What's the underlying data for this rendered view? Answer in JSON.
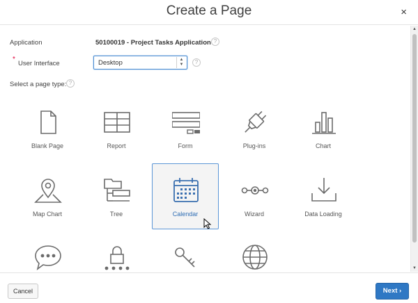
{
  "dialog": {
    "title": "Create a Page",
    "close_icon": "×"
  },
  "form": {
    "application_label": "Application",
    "application_value": "50100019 - Project Tasks Application",
    "ui_label": "User Interface",
    "ui_required_marker": "*",
    "ui_value": "Desktop",
    "page_type_label": "Select a page type:",
    "help_glyph": "?"
  },
  "page_types": [
    {
      "label": "Blank Page",
      "icon": "blank-page-icon"
    },
    {
      "label": "Report",
      "icon": "report-icon"
    },
    {
      "label": "Form",
      "icon": "form-icon"
    },
    {
      "label": "Plug-ins",
      "icon": "plug-icon"
    },
    {
      "label": "Chart",
      "icon": "chart-icon"
    },
    {
      "label": "Map Chart",
      "icon": "map-pin-icon"
    },
    {
      "label": "Tree",
      "icon": "tree-icon"
    },
    {
      "label": "Calendar",
      "icon": "calendar-icon",
      "selected": true
    },
    {
      "label": "Wizard",
      "icon": "wizard-icon"
    },
    {
      "label": "Data Loading",
      "icon": "data-loading-icon"
    },
    {
      "label": "",
      "icon": "chat-bubble-icon"
    },
    {
      "label": "",
      "icon": "lock-icon"
    },
    {
      "label": "",
      "icon": "key-icon"
    },
    {
      "label": "",
      "icon": "globe-icon"
    }
  ],
  "footer": {
    "cancel_label": "Cancel",
    "next_label": "Next",
    "next_chevron": "›"
  },
  "colors": {
    "accent": "#2f78c4",
    "selected_border": "#5b95d6",
    "icon_gray": "#6b6b6b",
    "required": "#e0003a"
  }
}
